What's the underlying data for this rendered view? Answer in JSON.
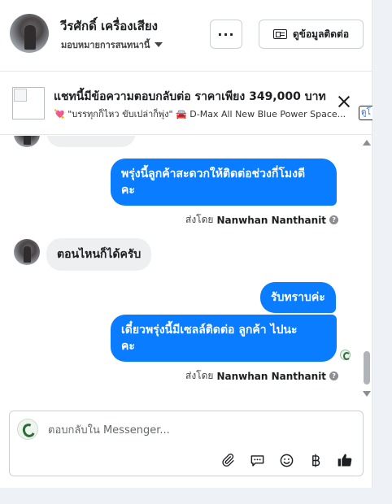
{
  "header": {
    "contact_name": "วีรศักดิ์ เครื่องเสียง",
    "assign_label": "มอบหมายการสนทนานี้",
    "more_label": "···",
    "contact_info_label": "ดูข้อมูลติดต่อ"
  },
  "ad": {
    "title": "แชทนี้มีข้อความตอบกลับต่อ ราคาเพียง 349,000 บาท",
    "subtitle": "💘 \"บรรทุกก็ไหว ขับเปล่าก็พุ่ง\" 🚘 D-Max All New Blue Power Space...",
    "cut_label": "ดูโ"
  },
  "messages": {
    "out_1": "พรุ่งนี้ลูกค้าสะดวกให้ติดต่อช่วงกี่โมงดี\nคะ",
    "sent_by_prefix": "ส่งโดย",
    "sent_by_name": "Nanwhan Nanthanit",
    "in_1": "ตอนไหนก็ได้ครับ",
    "out_2": "รับทราบค่ะ",
    "out_3": "เดี๋ยวพรุ่งนี้มีเซลล์ติดต่อ ลูกค้า  ไปนะ\nคะ"
  },
  "composer": {
    "placeholder": "ตอบกลับใน Messenger..."
  },
  "colors": {
    "accent_blue": "#0a7cff",
    "incoming_bubble": "#eeeff1",
    "page_bg": "#eef2f6"
  }
}
